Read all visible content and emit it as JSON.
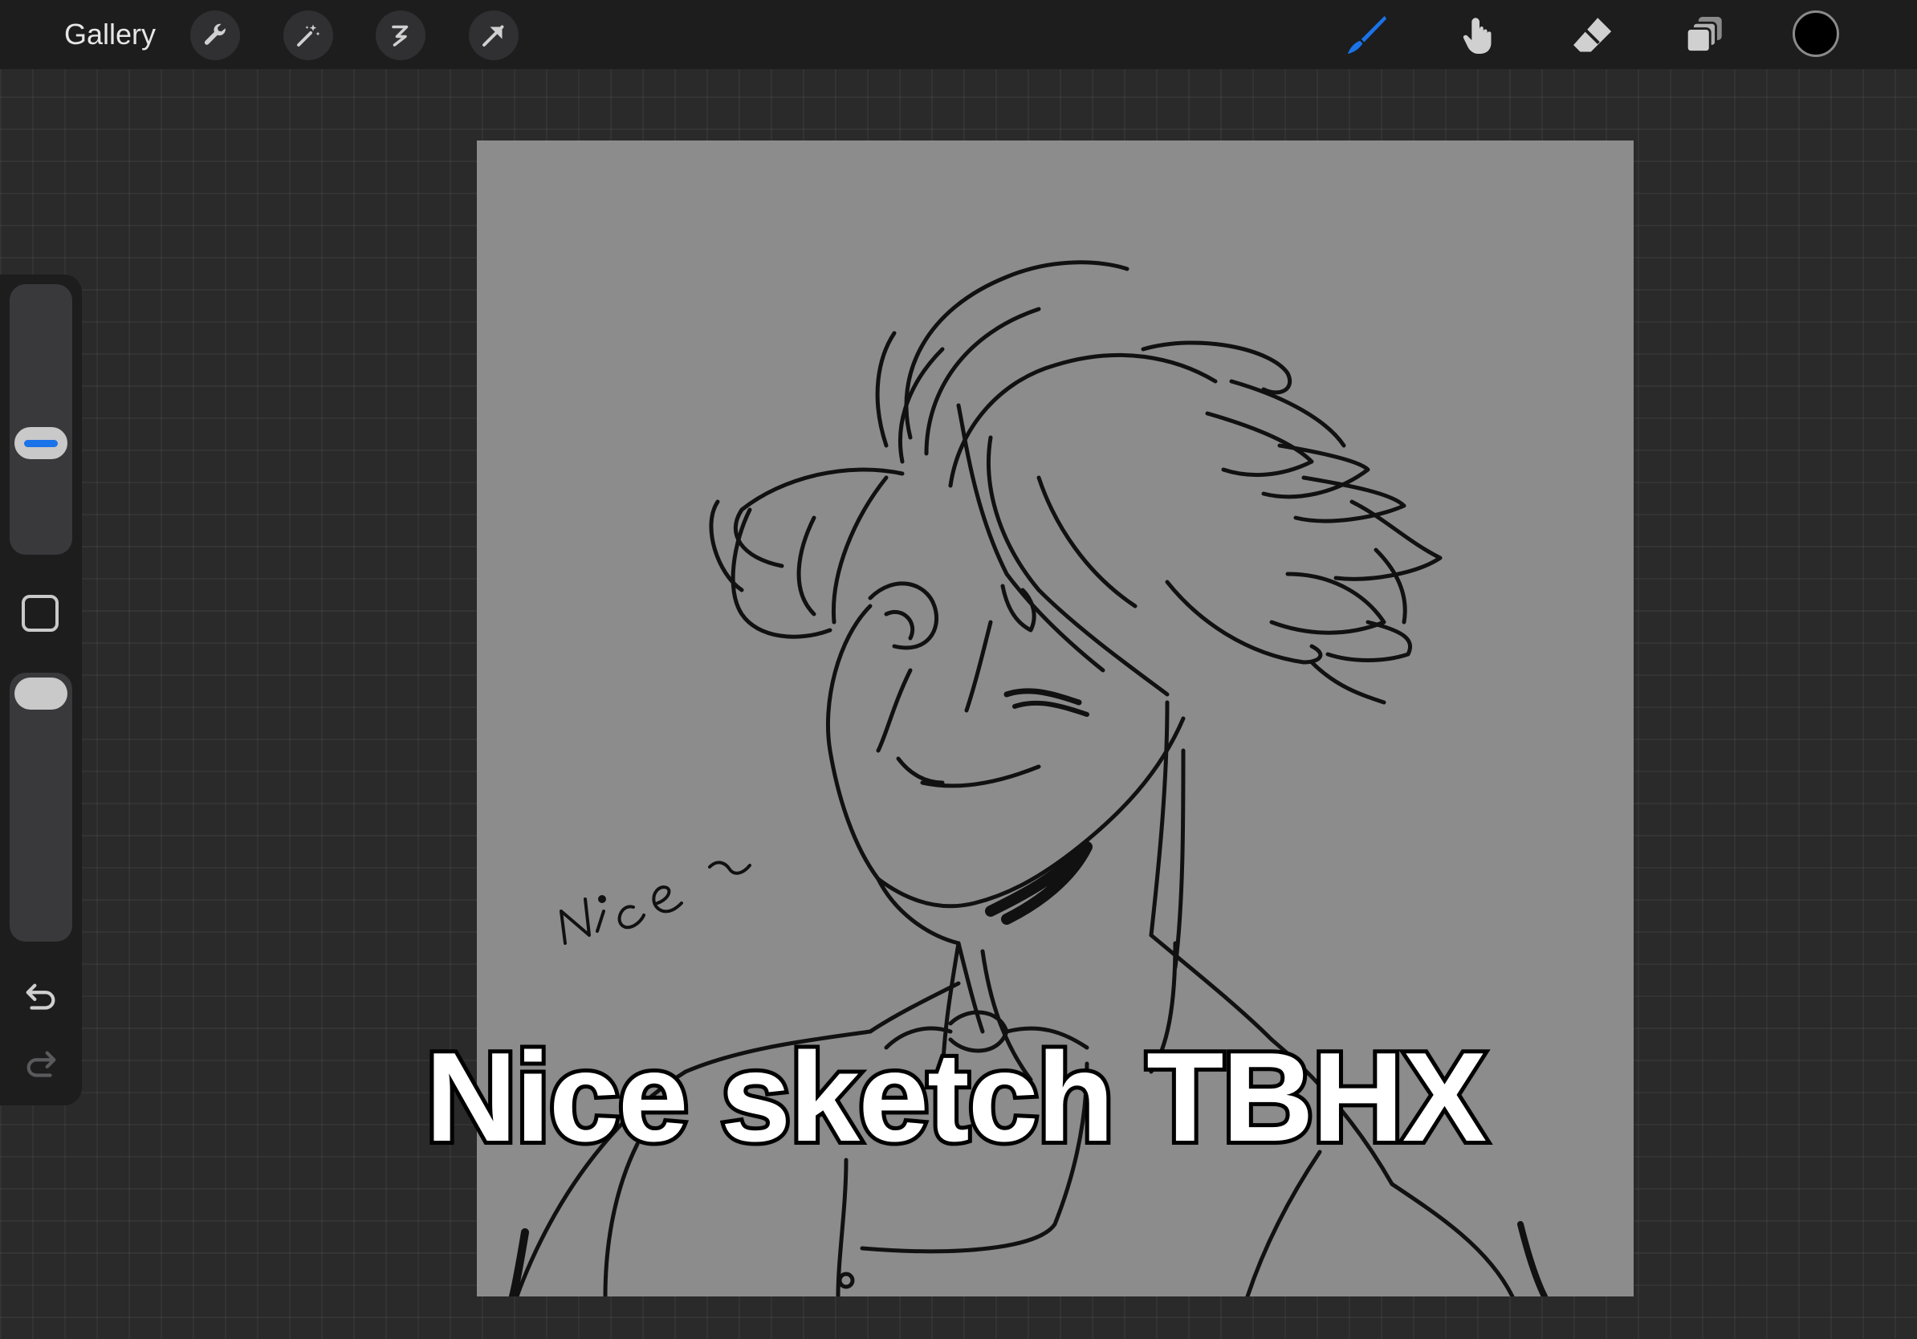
{
  "topbar": {
    "gallery_label": "Gallery",
    "left_tools": [
      "wrench-icon",
      "magic-wand-icon",
      "selection-icon",
      "transform-arrow-icon"
    ],
    "right_tools": [
      "brush-icon",
      "smudge-icon",
      "eraser-icon",
      "layers-icon"
    ],
    "active_tool": "brush",
    "accent_color": "#1a73e8",
    "current_color": "#000000"
  },
  "sidebar": {
    "brush_size_level": 0.35,
    "opacity_level": 0.0
  },
  "canvas": {
    "background_color": "#8c8c8c",
    "handwritten_text": "Nice ~"
  },
  "caption": {
    "text": "Nice sketch TBHX"
  }
}
